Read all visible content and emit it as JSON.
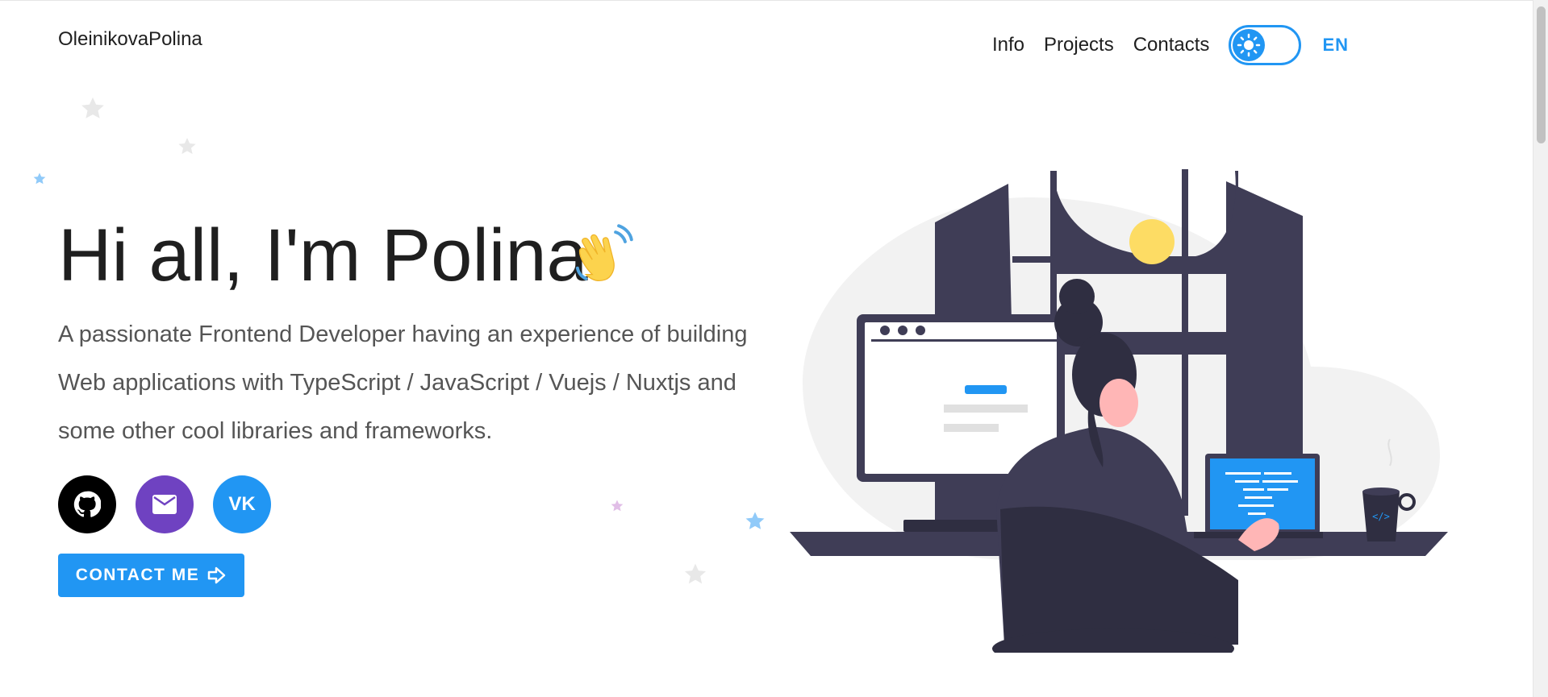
{
  "header": {
    "logo": "OleinikovaPolina",
    "nav": [
      "Info",
      "Projects",
      "Contacts"
    ],
    "theme_toggle": {
      "icon": "sun-icon",
      "state": "light"
    },
    "lang": "EN"
  },
  "hero": {
    "title": "Hi all, I'm Polina",
    "wave_icon": "waving-hand-icon",
    "subtitle": "A passionate Frontend Developer having an experience of building Web applications with TypeScript / JavaScript / Vuejs / Nuxtjs and some other cool libraries and frameworks.",
    "socials": [
      {
        "name": "github",
        "icon": "github-icon",
        "color": "#000000"
      },
      {
        "name": "email",
        "icon": "mail-icon",
        "color": "#6f42c1"
      },
      {
        "name": "vk",
        "label": "VK",
        "color": "#2196f3"
      }
    ],
    "cta": "CONTACT ME"
  },
  "colors": {
    "accent": "#2196f3",
    "dark_figure": "#3f3d56",
    "text": "#1f1f1f"
  }
}
